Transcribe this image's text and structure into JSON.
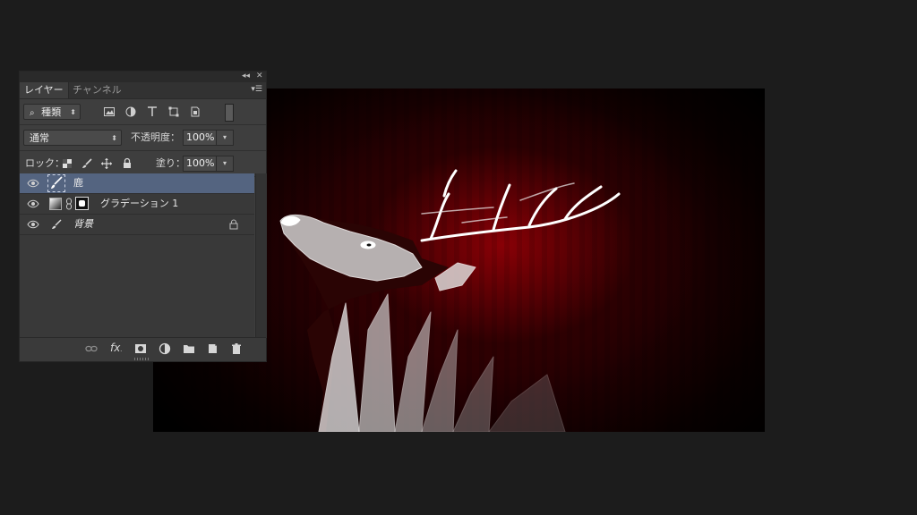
{
  "panel": {
    "tabs": [
      "レイヤー",
      "チャンネル"
    ],
    "filter": {
      "kind_label": "種類"
    },
    "blend": {
      "mode": "通常",
      "opacity_label": "不透明度：",
      "opacity_value": "100%"
    },
    "lock": {
      "label": "ロック：",
      "fill_label": "塗り：",
      "fill_value": "100%"
    },
    "layers": [
      {
        "name": "鹿",
        "selected": true
      },
      {
        "name": "グラデーション 1",
        "selected": false
      },
      {
        "name": "背景",
        "selected": false,
        "locked": true
      }
    ]
  },
  "colors": {
    "background": "#1c1c1c",
    "panel": "#3e3e3e",
    "selected_layer": "#546480",
    "artwork_red": "#8c0006"
  }
}
